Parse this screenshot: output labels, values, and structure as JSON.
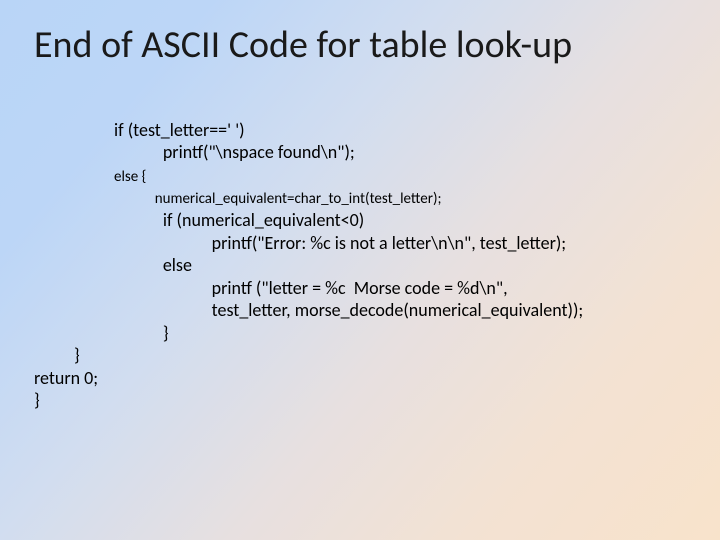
{
  "title": "End of ASCII Code for table look-up",
  "code": {
    "l1": "if (test_letter==' ')",
    "l2": "            printf(\"\\nspace found\\n\");",
    "l3": "else {",
    "l4": "            numerical_equivalent=char_to_int(test_letter);",
    "l5": "            if (numerical_equivalent<0)",
    "l6": "                        printf(\"Error: %c is not a letter\\n\\n\", test_letter);",
    "l7": "            else",
    "l8": "                        printf (\"letter = %c  Morse code = %d\\n\",",
    "l9": "                        test_letter, morse_decode(numerical_equivalent));",
    "l10": "            }",
    "l11": "}",
    "l12": "return 0;",
    "l13": "}"
  }
}
